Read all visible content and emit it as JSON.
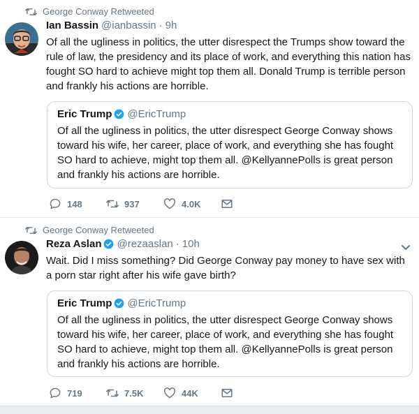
{
  "tweets": [
    {
      "retweeted_by": "George Conway Retweeted",
      "author_name": "Ian Bassin",
      "author_handle": "@ianbassin",
      "time": "9h",
      "text": "Of all the ugliness in politics, the utter disrespect the Trumps show toward the rule of law, the presidency and its place of work, and everything this nation has fought SO hard to achieve might top them all. Donald Trump is terrible person and frankly his actions are horrible.",
      "quote": {
        "author_name": "Eric Trump",
        "author_handle": "@EricTrump",
        "text": "Of all the ugliness in politics, the utter disrespect George Conway shows toward his wife, her career, place of work, and everything she has fought SO hard to achieve, might top them all. @KellyannePolls is great person and frankly his actions are horrible."
      },
      "actions": {
        "replies": "148",
        "retweets": "937",
        "likes": "4.0K"
      }
    },
    {
      "retweeted_by": "George Conway Retweeted",
      "author_name": "Reza Aslan",
      "author_handle": "@rezaaslan",
      "time": "10h",
      "text": "Wait. Did I miss something? Did George Conway pay money to have sex with a porn star right after his wife gave birth?",
      "quote": {
        "author_name": "Eric Trump",
        "author_handle": "@EricTrump",
        "text": "Of all the ugliness in politics, the utter disrespect George Conway shows toward his wife, her career, place of work, and everything she has fought SO hard to achieve, might top them all. @KellyannePolls is great person and frankly his actions are horrible."
      },
      "actions": {
        "replies": "719",
        "retweets": "7.5K",
        "likes": "44K"
      }
    }
  ],
  "separator": "·",
  "colors": {
    "accent": "#1da1f2",
    "muted": "#657786",
    "text": "#14171a",
    "border": "#ccd6dd",
    "background": "#ffffff"
  },
  "icons": [
    "retweet-icon",
    "verified-badge-icon",
    "chevron-down-icon",
    "reply-icon",
    "like-icon",
    "message-icon"
  ]
}
